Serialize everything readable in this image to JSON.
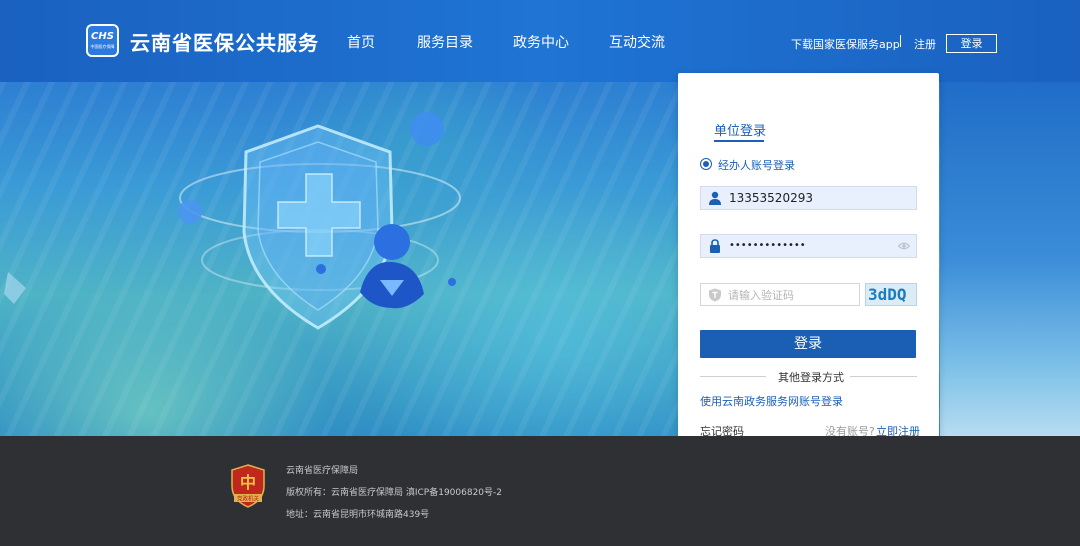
{
  "header": {
    "logo_text": "CHS",
    "logo_subtext": "中国医疗保障",
    "site_title": "云南省医保公共服务",
    "nav": [
      "首页",
      "服务目录",
      "政务中心",
      "互动交流"
    ],
    "download_app": "下载国家医保服务app",
    "register": "注册",
    "login": "登录"
  },
  "login_card": {
    "tab_label": "单位登录",
    "radio_label": "经办人账号登录",
    "account_value": "13353520293",
    "password_mask": "•••••••••••••",
    "captcha_placeholder": "请输入验证码",
    "captcha_image_text": "3dDQ",
    "submit_label": "登录",
    "other_methods_label": "其他登录方式",
    "gov_login_link": "使用云南政务服务网账号登录",
    "forgot_password": "忘记密码",
    "no_account_prompt": "没有账号?",
    "register_now": "立即注册"
  },
  "footer": {
    "badge_text": "党政机关",
    "org_name": "云南省医疗保障局",
    "copyright": "版权所有：云南省医疗保障局 滇ICP备19006820号-2",
    "address": "地址：云南省昆明市环城南路439号"
  },
  "colors": {
    "primary": "#1a5fb4",
    "header_bg": "#1f6dcb",
    "footer_bg": "#2e3033",
    "field_bg": "#e8f0fe"
  }
}
